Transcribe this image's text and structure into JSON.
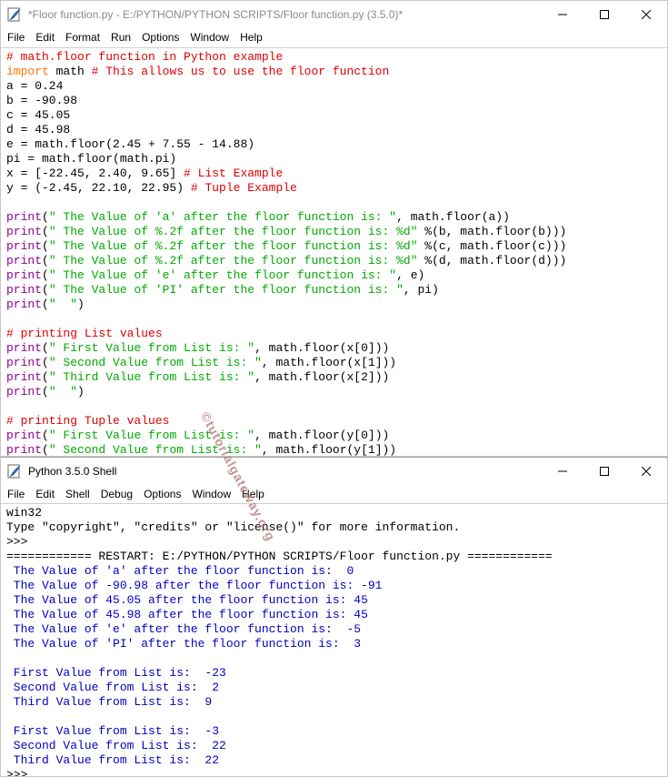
{
  "editor": {
    "title": "*Floor function.py - E:/PYTHON/PYTHON SCRIPTS/Floor function.py (3.5.0)*",
    "menu": [
      "File",
      "Edit",
      "Format",
      "Run",
      "Options",
      "Window",
      "Help"
    ],
    "lines": [
      [
        {
          "t": "# math.floor function in Python example",
          "c": "com"
        }
      ],
      [
        {
          "t": "import",
          "c": "kw"
        },
        {
          "t": " math ",
          "c": ""
        },
        {
          "t": "# This allows us to use the floor function",
          "c": "com"
        }
      ],
      [
        {
          "t": "a = 0.24",
          "c": ""
        }
      ],
      [
        {
          "t": "b = -90.98",
          "c": ""
        }
      ],
      [
        {
          "t": "c = 45.05",
          "c": ""
        }
      ],
      [
        {
          "t": "d = 45.98",
          "c": ""
        }
      ],
      [
        {
          "t": "e = math.floor(2.45 + 7.55 - 14.88)",
          "c": ""
        }
      ],
      [
        {
          "t": "pi = math.floor(math.pi)",
          "c": ""
        }
      ],
      [
        {
          "t": "x = [-22.45, 2.40, 9.65] ",
          "c": ""
        },
        {
          "t": "# List Example",
          "c": "com"
        }
      ],
      [
        {
          "t": "y = (-2.45, 22.10, 22.95) ",
          "c": ""
        },
        {
          "t": "# Tuple Example",
          "c": "com"
        }
      ],
      [],
      [
        {
          "t": "print",
          "c": "bi"
        },
        {
          "t": "(",
          "c": ""
        },
        {
          "t": "\" The Value of 'a' after the floor function is: \"",
          "c": "str"
        },
        {
          "t": ", math.floor(a))",
          "c": ""
        }
      ],
      [
        {
          "t": "print",
          "c": "bi"
        },
        {
          "t": "(",
          "c": ""
        },
        {
          "t": "\" The Value of %.2f after the floor function is: %d\"",
          "c": "str"
        },
        {
          "t": " %(b, math.floor(b)))",
          "c": ""
        }
      ],
      [
        {
          "t": "print",
          "c": "bi"
        },
        {
          "t": "(",
          "c": ""
        },
        {
          "t": "\" The Value of %.2f after the floor function is: %d\"",
          "c": "str"
        },
        {
          "t": " %(c, math.floor(c)))",
          "c": ""
        }
      ],
      [
        {
          "t": "print",
          "c": "bi"
        },
        {
          "t": "(",
          "c": ""
        },
        {
          "t": "\" The Value of %.2f after the floor function is: %d\"",
          "c": "str"
        },
        {
          "t": " %(d, math.floor(d)))",
          "c": ""
        }
      ],
      [
        {
          "t": "print",
          "c": "bi"
        },
        {
          "t": "(",
          "c": ""
        },
        {
          "t": "\" The Value of 'e' after the floor function is: \"",
          "c": "str"
        },
        {
          "t": ", e)",
          "c": ""
        }
      ],
      [
        {
          "t": "print",
          "c": "bi"
        },
        {
          "t": "(",
          "c": ""
        },
        {
          "t": "\" The Value of 'PI' after the floor function is: \"",
          "c": "str"
        },
        {
          "t": ", pi)",
          "c": ""
        }
      ],
      [
        {
          "t": "print",
          "c": "bi"
        },
        {
          "t": "(",
          "c": ""
        },
        {
          "t": "\"  \"",
          "c": "str"
        },
        {
          "t": ")",
          "c": ""
        }
      ],
      [],
      [
        {
          "t": "# printing List values",
          "c": "com"
        }
      ],
      [
        {
          "t": "print",
          "c": "bi"
        },
        {
          "t": "(",
          "c": ""
        },
        {
          "t": "\" First Value from List is: \"",
          "c": "str"
        },
        {
          "t": ", math.floor(x[0]))",
          "c": ""
        }
      ],
      [
        {
          "t": "print",
          "c": "bi"
        },
        {
          "t": "(",
          "c": ""
        },
        {
          "t": "\" Second Value from List is: \"",
          "c": "str"
        },
        {
          "t": ", math.floor(x[1]))",
          "c": ""
        }
      ],
      [
        {
          "t": "print",
          "c": "bi"
        },
        {
          "t": "(",
          "c": ""
        },
        {
          "t": "\" Third Value from List is: \"",
          "c": "str"
        },
        {
          "t": ", math.floor(x[2]))",
          "c": ""
        }
      ],
      [
        {
          "t": "print",
          "c": "bi"
        },
        {
          "t": "(",
          "c": ""
        },
        {
          "t": "\"  \"",
          "c": "str"
        },
        {
          "t": ")",
          "c": ""
        }
      ],
      [],
      [
        {
          "t": "# printing Tuple values",
          "c": "com"
        }
      ],
      [
        {
          "t": "print",
          "c": "bi"
        },
        {
          "t": "(",
          "c": ""
        },
        {
          "t": "\" First Value from List is: \"",
          "c": "str"
        },
        {
          "t": ", math.floor(y[0]))",
          "c": ""
        }
      ],
      [
        {
          "t": "print",
          "c": "bi"
        },
        {
          "t": "(",
          "c": ""
        },
        {
          "t": "\" Second Value from List is: \"",
          "c": "str"
        },
        {
          "t": ", math.floor(y[1]))",
          "c": ""
        }
      ]
    ]
  },
  "shell": {
    "title": "Python 3.5.0 Shell",
    "menu": [
      "File",
      "Edit",
      "Shell",
      "Debug",
      "Options",
      "Window",
      "Help"
    ],
    "lines": [
      [
        {
          "t": "win32",
          "c": ""
        }
      ],
      [
        {
          "t": "Type \"copyright\", \"credits\" or \"license()\" for more information.",
          "c": ""
        }
      ],
      [
        {
          "t": ">>> ",
          "c": ""
        }
      ],
      [
        {
          "t": "============ RESTART: E:/PYTHON/PYTHON SCRIPTS/Floor function.py ============",
          "c": ""
        }
      ],
      [
        {
          "t": " The Value of 'a' after the floor function is:  0",
          "c": "out"
        }
      ],
      [
        {
          "t": " The Value of -90.98 after the floor function is: -91",
          "c": "out"
        }
      ],
      [
        {
          "t": " The Value of 45.05 after the floor function is: 45",
          "c": "out"
        }
      ],
      [
        {
          "t": " The Value of 45.98 after the floor function is: 45",
          "c": "out"
        }
      ],
      [
        {
          "t": " The Value of 'e' after the floor function is:  -5",
          "c": "out"
        }
      ],
      [
        {
          "t": " The Value of 'PI' after the floor function is:  3",
          "c": "out"
        }
      ],
      [
        {
          "t": "   ",
          "c": "out"
        }
      ],
      [
        {
          "t": " First Value from List is:  -23",
          "c": "out"
        }
      ],
      [
        {
          "t": " Second Value from List is:  2",
          "c": "out"
        }
      ],
      [
        {
          "t": " Third Value from List is:  9",
          "c": "out"
        }
      ],
      [
        {
          "t": "   ",
          "c": "out"
        }
      ],
      [
        {
          "t": " First Value from List is:  -3",
          "c": "out"
        }
      ],
      [
        {
          "t": " Second Value from List is:  22",
          "c": "out"
        }
      ],
      [
        {
          "t": " Third Value from List is:  22",
          "c": "out"
        }
      ],
      [
        {
          "t": ">>> ",
          "c": ""
        }
      ]
    ]
  },
  "watermark": "©tutorialgateway.org",
  "colors": {
    "comment": "#dd0000",
    "keyword": "#ff7700",
    "builtin": "#900090",
    "string": "#00aa00",
    "output": "#0000c0",
    "watermark": "#b07070"
  },
  "icons": {
    "app": "idle-feather-icon",
    "minimize": "minimize-icon",
    "maximize": "maximize-icon",
    "close": "close-icon"
  }
}
